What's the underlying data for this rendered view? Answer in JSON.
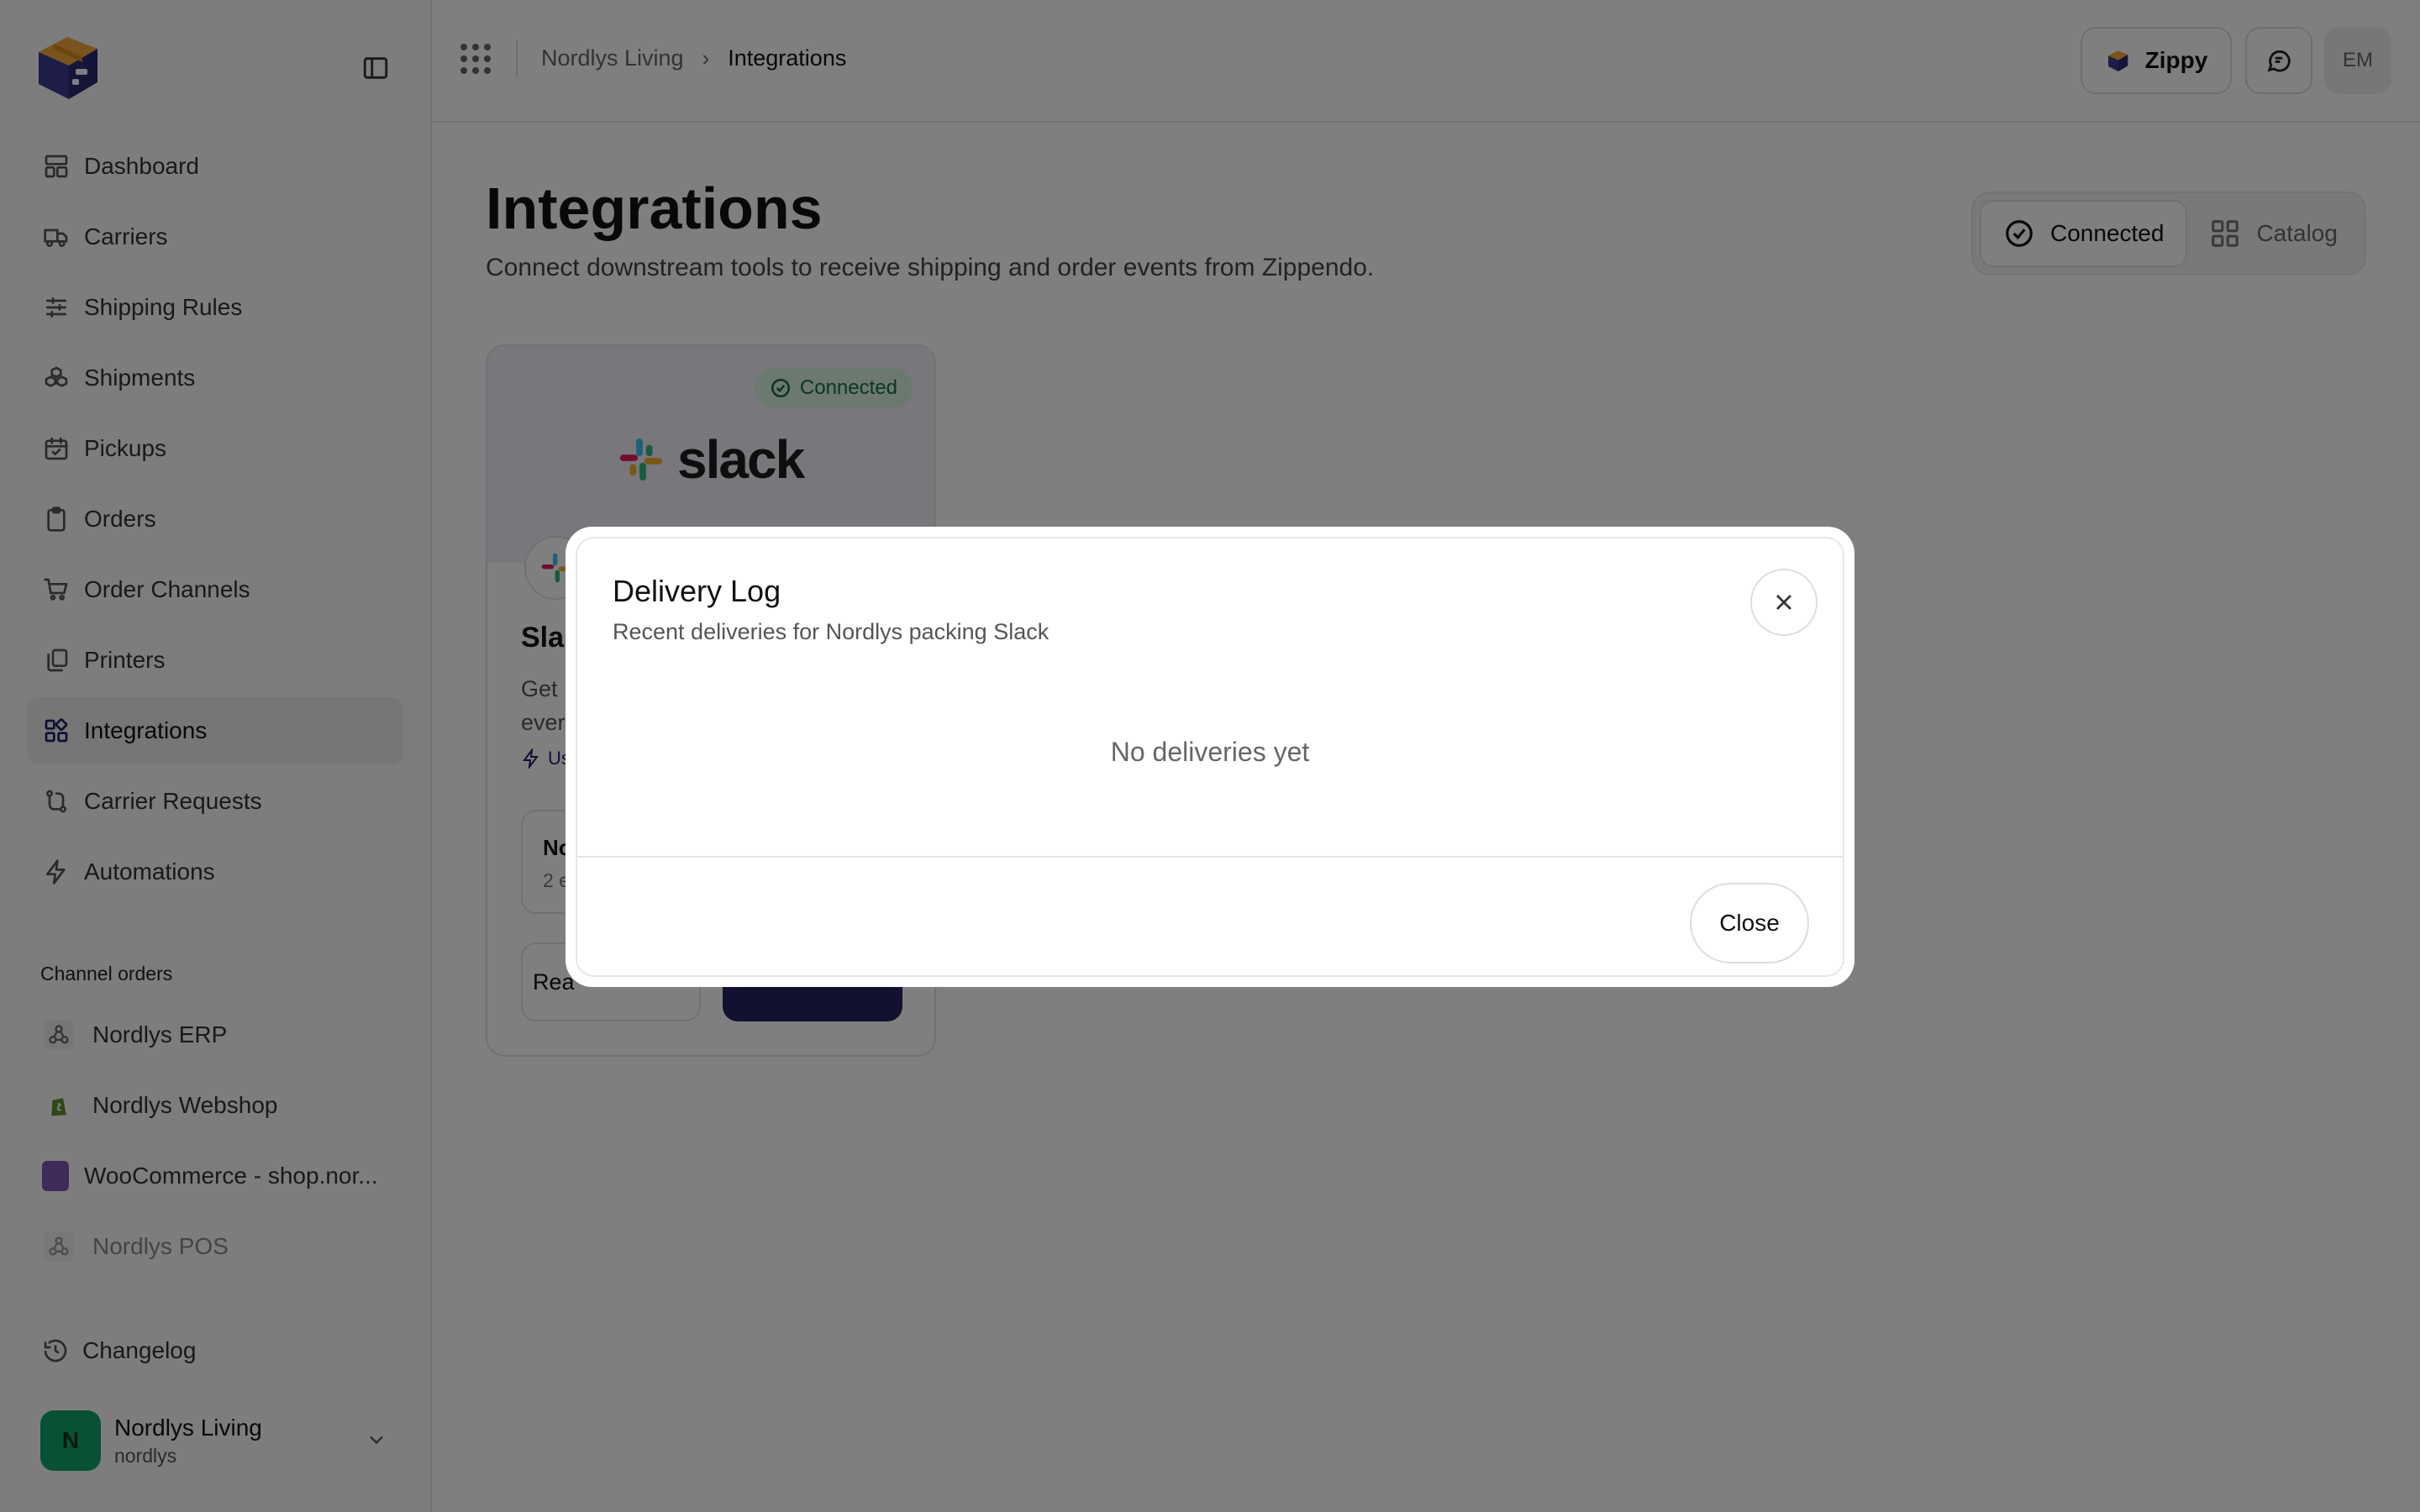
{
  "sidebar": {
    "nav": [
      {
        "label": "Dashboard",
        "icon": "dashboard-icon"
      },
      {
        "label": "Carriers",
        "icon": "truck-icon"
      },
      {
        "label": "Shipping Rules",
        "icon": "sliders-icon"
      },
      {
        "label": "Shipments",
        "icon": "boxes-icon"
      },
      {
        "label": "Pickups",
        "icon": "calendar-check-icon"
      },
      {
        "label": "Orders",
        "icon": "clipboard-icon"
      },
      {
        "label": "Order Channels",
        "icon": "cart-icon"
      },
      {
        "label": "Printers",
        "icon": "copy-icon"
      },
      {
        "label": "Integrations",
        "icon": "integrations-icon",
        "active": true
      },
      {
        "label": "Carrier Requests",
        "icon": "route-icon"
      },
      {
        "label": "Automations",
        "icon": "bolt-icon"
      }
    ],
    "section_label": "Channel orders",
    "channels": [
      {
        "label": "Nordlys ERP",
        "icon": "webhook-icon"
      },
      {
        "label": "Nordlys Webshop",
        "icon": "shopify-icon"
      },
      {
        "label": "WooCommerce - shop.nor...",
        "icon": "woocommerce-icon"
      },
      {
        "label": "Nordlys POS",
        "icon": "webhook-icon",
        "dim": true
      }
    ],
    "changelog": "Changelog",
    "account": {
      "initial": "N",
      "name": "Nordlys Living",
      "handle": "nordlys"
    }
  },
  "topbar": {
    "breadcrumb": [
      "Nordlys Living",
      "Integrations"
    ],
    "zippy_label": "Zippy",
    "user_initials": "EM"
  },
  "main": {
    "title": "Integrations",
    "description": "Connect downstream tools to receive shipping and order events from Zippendo.",
    "tabs": [
      {
        "label": "Connected",
        "active": true
      },
      {
        "label": "Catalog",
        "active": false
      }
    ],
    "card": {
      "status": "Connected",
      "logo_text": "slack",
      "title": "Sla",
      "description": "Get\never",
      "usage": "Us",
      "sub_title": "No",
      "sub_meta": "2 e",
      "readme_label": "Rea"
    }
  },
  "modal": {
    "title": "Delivery Log",
    "subtitle": "Recent deliveries for Nordlys packing Slack",
    "empty": "No deliveries yet",
    "close_label": "Close"
  },
  "colors": {
    "accent": "#25235f",
    "connected_bg": "#d6f3e3",
    "connected_fg": "#1f6b41",
    "avatar": "#12a36a",
    "overlay": "rgba(0,0,0,0.5)"
  }
}
